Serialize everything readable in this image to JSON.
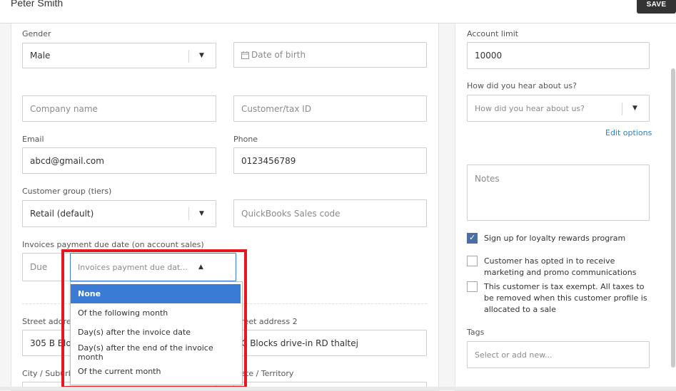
{
  "header": {
    "customer_name": "Peter Smith",
    "save_label": "SAVE"
  },
  "form": {
    "gender": {
      "label": "Gender",
      "value": "Male"
    },
    "dob": {
      "placeholder": "Date of birth"
    },
    "company": {
      "placeholder": "Company name"
    },
    "tax_id": {
      "placeholder": "Customer/tax ID"
    },
    "email": {
      "label": "Email",
      "value": "abcd@gmail.com"
    },
    "phone": {
      "label": "Phone",
      "value": "0123456789"
    },
    "group": {
      "label": "Customer group (tiers)",
      "value": "Retail (default)"
    },
    "qb_code": {
      "placeholder": "QuickBooks Sales code"
    },
    "due": {
      "label": "Invoices payment due date (on account sales)",
      "due_placeholder": "Due",
      "select_placeholder": "Invoices payment due dat...",
      "options": [
        "None",
        "Of the following month",
        "Day(s) after the invoice date",
        "Day(s) after the end of the invoice month",
        "Of the current month"
      ],
      "selected_index": 0
    },
    "street1": {
      "label": "Street address",
      "value": "305 B Bloc"
    },
    "street2": {
      "label": "Street address 2",
      "value": "C Blocks drive-in RD thaltej"
    },
    "city": {
      "label": "City / Suburb"
    },
    "state": {
      "label": "State / Territory"
    }
  },
  "side": {
    "account_limit": {
      "label": "Account limit",
      "value": "10000"
    },
    "hear": {
      "label": "How did you hear about us?",
      "placeholder": "How did you hear about us?"
    },
    "edit_options": "Edit options",
    "notes": {
      "placeholder": "Notes"
    },
    "checkboxes": [
      {
        "label": "Sign up for loyalty rewards program",
        "checked": true
      },
      {
        "label": "Customer has opted in to receive marketing and promo communications",
        "checked": false
      },
      {
        "label": "This customer is tax exempt. All taxes to be removed when this customer profile is allocated to a sale",
        "checked": false
      }
    ],
    "tags": {
      "label": "Tags",
      "placeholder": "Select or add new..."
    }
  },
  "colors": {
    "accent": "#3a7bd5",
    "highlight": "#e8171f",
    "save_bg": "#333333"
  },
  "icons": {
    "dob": "calendar-icon",
    "dropdown": "caret-down-icon",
    "open_dropdown": "caret-up-icon"
  }
}
